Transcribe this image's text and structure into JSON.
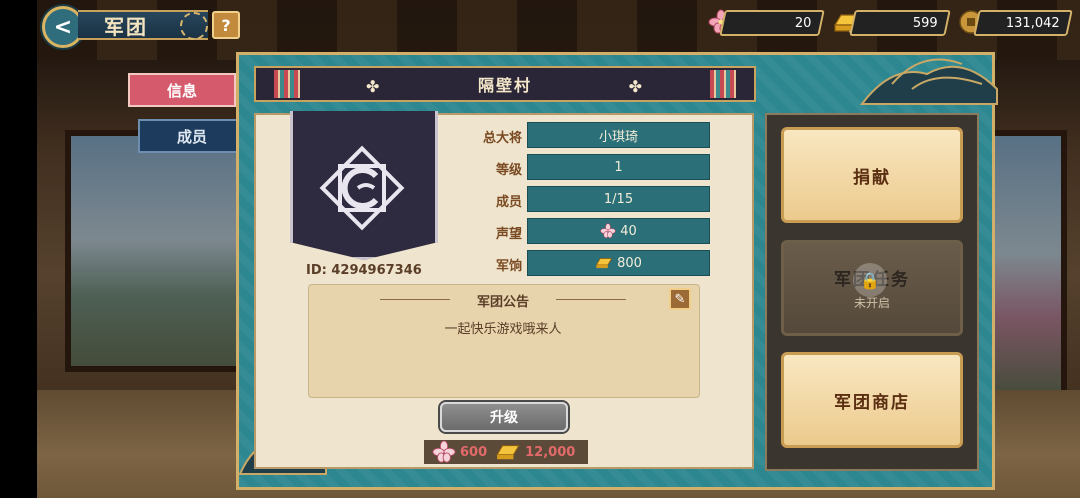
{
  "header": {
    "back_label": "<",
    "title": "军团",
    "help_label": "?"
  },
  "resources": [
    {
      "icon": "sakura-icon",
      "value": "20"
    },
    {
      "icon": "gold-bar-icon",
      "value": "599"
    },
    {
      "icon": "coin-icon",
      "value": "131,042"
    }
  ],
  "tabs": [
    {
      "label": "信息",
      "active": true
    },
    {
      "label": "成员",
      "active": false
    }
  ],
  "legion": {
    "name": "隔壁村",
    "id_text": "ID: 4294967346",
    "rows": [
      {
        "label": "总大将",
        "value": "小琪琦"
      },
      {
        "label": "等级",
        "value": "1"
      },
      {
        "label": "成员",
        "value": "1/15"
      },
      {
        "label": "声望",
        "value": "40"
      },
      {
        "label": "军饷",
        "value": "800"
      }
    ]
  },
  "notice": {
    "title": "军团公告",
    "body": "一起快乐游戏哦来人"
  },
  "upgrade": {
    "label": "升级",
    "cost_sakura": "600",
    "cost_gold": "12,000"
  },
  "actions": {
    "donate": "捐献",
    "tasks": "军团任务",
    "tasks_status": "未开启",
    "shop": "军团商店"
  },
  "colors": {
    "panel": "#2d8790",
    "accent_gold": "#d2b06a",
    "tab_active": "#d55a6c",
    "tab_inactive": "#1d3b5c"
  }
}
